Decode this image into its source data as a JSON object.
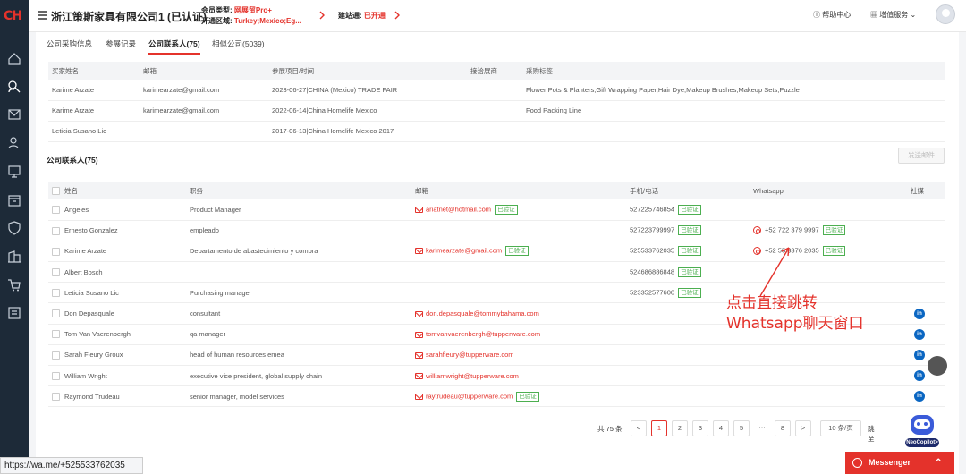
{
  "sidebar": {
    "logo": "CH",
    "icons": [
      "home-icon",
      "search-user-icon",
      "mail-icon",
      "user-icon",
      "monitor-icon",
      "box-icon",
      "shield-icon",
      "building-icon",
      "cart-icon",
      "report-icon"
    ]
  },
  "header": {
    "company": "浙江策斯家具有限公司1 (已认证)",
    "member_type_label": "会员类型:",
    "member_type_value": "网展贸Pro+",
    "region_label": "开通区域:",
    "region_value": "Turkey;Mexico;Eg...",
    "site_label": "建站通:",
    "site_value": "已开通",
    "help": "帮助中心",
    "service": "增值服务"
  },
  "tabs": [
    "公司采购信息",
    "参展记录",
    "公司联系人(75)",
    "相似公司(5039)"
  ],
  "exhibit_table": {
    "headers": [
      "买家姓名",
      "邮箱",
      "参展项目/时间",
      "接洽展商",
      "采购标签"
    ],
    "rows": [
      [
        "Karime Arzate",
        "karimearzate@gmail.com",
        "2023-06-27|CHINA (Mexico) TRADE FAIR",
        "",
        "Flower Pots & Planters,Gift Wrapping Paper,Hair Dye,Makeup Brushes,Makeup Sets,Puzzle"
      ],
      [
        "Karime Arzate",
        "karimearzate@gmail.com",
        "2022-06-14|China Homelife Mexico",
        "",
        "Food Packing Line"
      ],
      [
        "Leticia Susano Lic",
        "",
        "2017-06-13|China Homelife Mexico 2017",
        "",
        ""
      ]
    ]
  },
  "contacts": {
    "title": "公司联系人(75)",
    "send_button": "发送邮件",
    "headers": [
      "姓名",
      "职务",
      "邮箱",
      "手机/电话",
      "Whatsapp",
      "社媒"
    ],
    "verified_label": "已验证",
    "rows": [
      {
        "name": "Angeles",
        "title": "Product Manager",
        "email": "ariatnet@hotmail.com",
        "email_verified": true,
        "phone": "527225746854",
        "phone_verified": true,
        "whatsapp": "",
        "wa_verified": false,
        "linkedin": false
      },
      {
        "name": "Ernesto Gonzalez",
        "title": "empleado",
        "email": "",
        "email_verified": false,
        "phone": "527223799997",
        "phone_verified": true,
        "whatsapp": "+52 722 379 9997",
        "wa_verified": true,
        "linkedin": false
      },
      {
        "name": "Karime Arzate",
        "title": "Departamento de abastecimiento y compra",
        "email": "karimearzate@gmail.com",
        "email_verified": true,
        "phone": "525533762035",
        "phone_verified": true,
        "whatsapp": "+52 55 3376 2035",
        "wa_verified": true,
        "linkedin": false
      },
      {
        "name": "Albert Bosch",
        "title": "",
        "email": "",
        "email_verified": false,
        "phone": "524686886848",
        "phone_verified": true,
        "whatsapp": "",
        "wa_verified": false,
        "linkedin": false
      },
      {
        "name": "Leticia Susano Lic",
        "title": "Purchasing manager",
        "email": "",
        "email_verified": false,
        "phone": "523352577600",
        "phone_verified": true,
        "whatsapp": "",
        "wa_verified": false,
        "linkedin": false
      },
      {
        "name": "Don Depasquale",
        "title": "consultant",
        "email": "don.depasquale@tommybahama.com",
        "email_verified": false,
        "phone": "",
        "phone_verified": false,
        "whatsapp": "",
        "wa_verified": false,
        "linkedin": true
      },
      {
        "name": "Tom Van Vaerenbergh",
        "title": "qa manager",
        "email": "tomvanvaerenbergh@tupperware.com",
        "email_verified": false,
        "phone": "",
        "phone_verified": false,
        "whatsapp": "",
        "wa_verified": false,
        "linkedin": true
      },
      {
        "name": "Sarah Fleury Groux",
        "title": "head of human resources emea",
        "email": "sarahfleury@tupperware.com",
        "email_verified": false,
        "phone": "",
        "phone_verified": false,
        "whatsapp": "",
        "wa_verified": false,
        "linkedin": true
      },
      {
        "name": "William Wright",
        "title": "executive vice president, global supply chain",
        "email": "williamwright@tupperware.com",
        "email_verified": false,
        "phone": "",
        "phone_verified": false,
        "whatsapp": "",
        "wa_verified": false,
        "linkedin": true
      },
      {
        "name": "Raymond Trudeau",
        "title": "senior manager, model services",
        "email": "raytrudeau@tupperware.com",
        "email_verified": true,
        "phone": "",
        "phone_verified": false,
        "whatsapp": "",
        "wa_verified": false,
        "linkedin": true
      }
    ]
  },
  "annotation": {
    "line1": "点击直接跳转",
    "line2": "Whatsapp聊天窗口"
  },
  "pagination": {
    "total": "共 75 条",
    "prev": "<",
    "pages": [
      "1",
      "2",
      "3",
      "4",
      "5",
      "···",
      "8"
    ],
    "next": ">",
    "page_size": "10 条/页",
    "goto": "跳至"
  },
  "status_url": "https://wa.me/+525533762035",
  "messenger": "Messenger",
  "neocopilot": "NeoCopilot>",
  "linkedin_glyph": "in"
}
